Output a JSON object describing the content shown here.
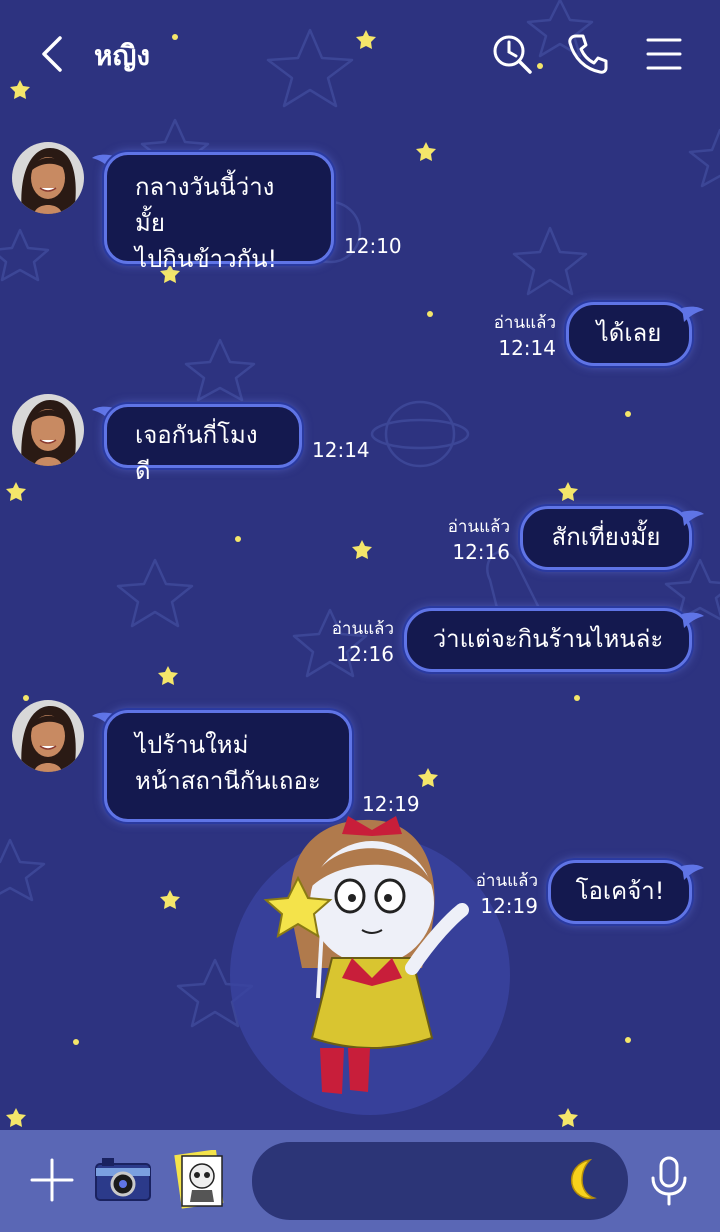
{
  "header": {
    "title": "หญิง"
  },
  "messages": [
    {
      "side": "left",
      "lines": [
        "กลางวันนี้ว่างมั้ย",
        "ไปกินข้าวกัน!"
      ],
      "time": "12:10"
    },
    {
      "side": "right",
      "text": "ได้เลย",
      "read": "อ่านแล้ว",
      "time": "12:14"
    },
    {
      "side": "left",
      "lines": [
        "เจอกันกี่โมงดี"
      ],
      "time": "12:14"
    },
    {
      "side": "right",
      "text": "สักเที่ยงมั้ย",
      "read": "อ่านแล้ว",
      "time": "12:16"
    },
    {
      "side": "right",
      "text": "ว่าแต่จะกินร้านไหนล่ะ",
      "read": "อ่านแล้ว",
      "time": "12:16"
    },
    {
      "side": "left",
      "lines": [
        "ไปร้านใหม่",
        "หน้าสถานีกันเถอะ"
      ],
      "time": "12:19"
    },
    {
      "side": "right",
      "text": "โอเคจ้า!",
      "read": "อ่านแล้ว",
      "time": "12:19"
    }
  ],
  "colors": {
    "background": "#2d3380",
    "bubble": "#14194f",
    "bubble_border": "#5f74e6",
    "bottom_bar": "#5a67b5",
    "star": "#f4e66a"
  },
  "icons": [
    "back-icon",
    "search-history-icon",
    "phone-icon",
    "menu-icon",
    "plus-icon",
    "camera-icon",
    "sticker-icon",
    "moon-icon",
    "microphone-icon"
  ]
}
